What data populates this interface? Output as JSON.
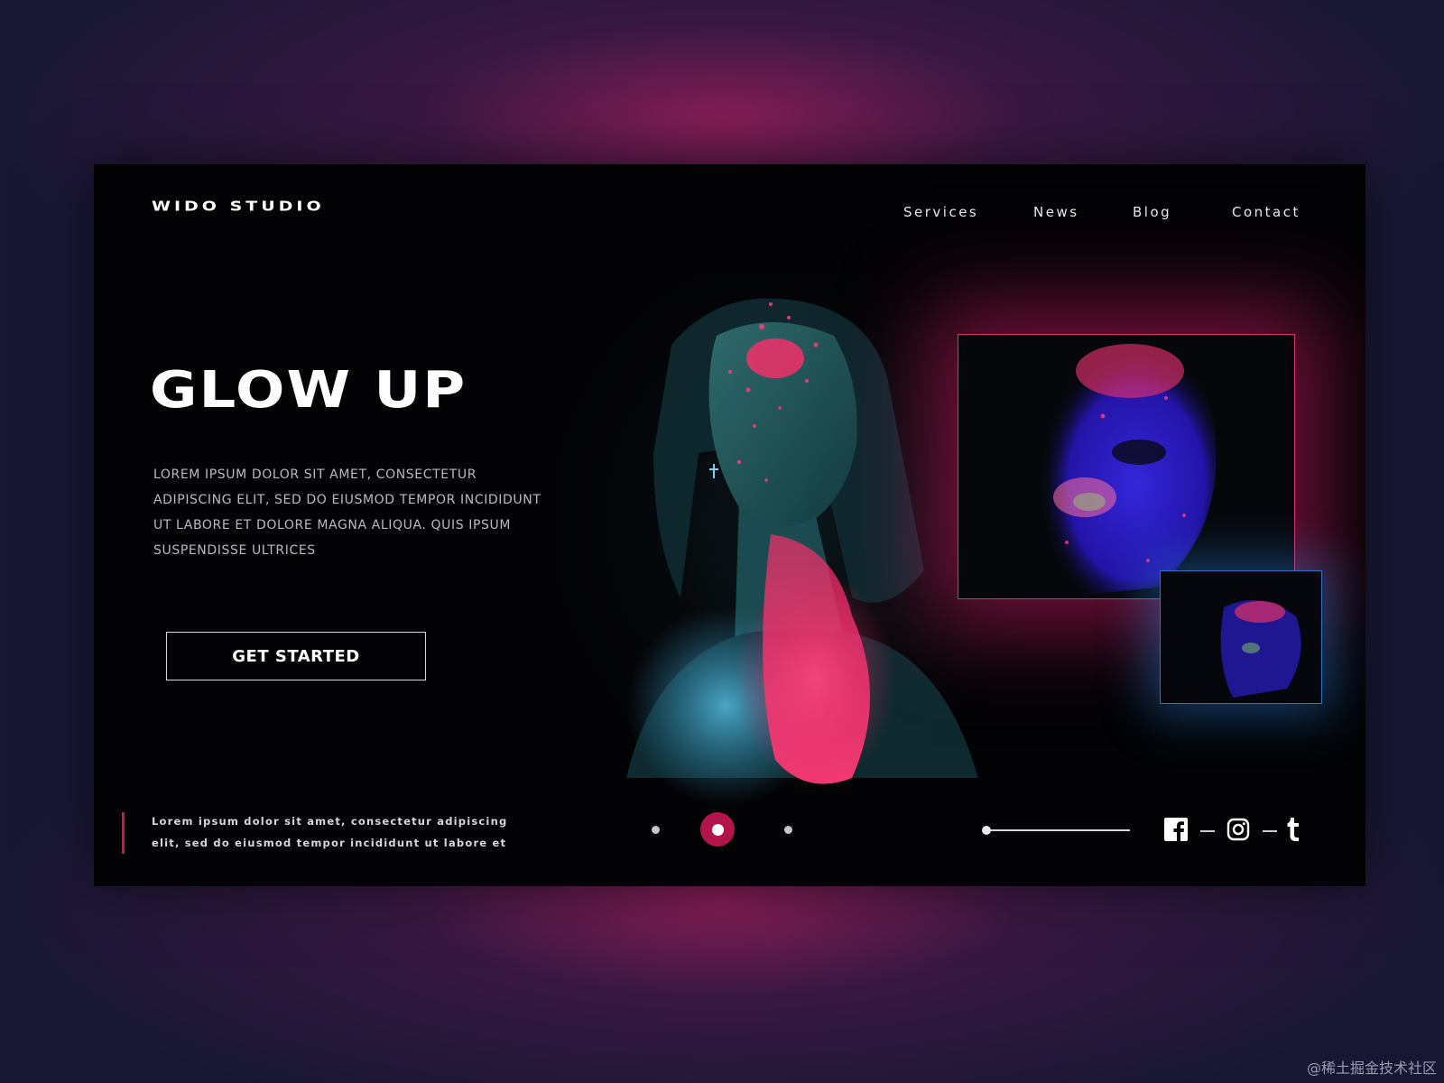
{
  "brand": {
    "logo": "WIDO STUDIO"
  },
  "nav": {
    "items": [
      "Services",
      "News",
      "Blog",
      "Contact"
    ]
  },
  "hero": {
    "title": "GLOW UP",
    "description": "Lorem ipsum dolor sit amet, consectetur adipiscing elit, sed do eiusmod tempor incididunt ut labore et dolore magna aliqua. Quis ipsum suspendisse ultrices",
    "cta_label": "GET STARTED"
  },
  "footer": {
    "text": "Lorem ipsum dolor sit amet, consectetur adipiscing elit, sed do eiusmod tempor incididunt ut labore et"
  },
  "carousel": {
    "slide_count": 3,
    "active_slide": 2
  },
  "social": {
    "icons": [
      "facebook-icon",
      "instagram-icon",
      "tumblr-icon"
    ]
  },
  "watermark": "@稀土掘金技术社区",
  "colors": {
    "background": "#171733",
    "frame": "#030305",
    "accent_pink": "#b1154b",
    "card_border_pink": "#e0306a",
    "card_border_blue": "#2f73c2",
    "text_muted": "#b9b9c4"
  }
}
